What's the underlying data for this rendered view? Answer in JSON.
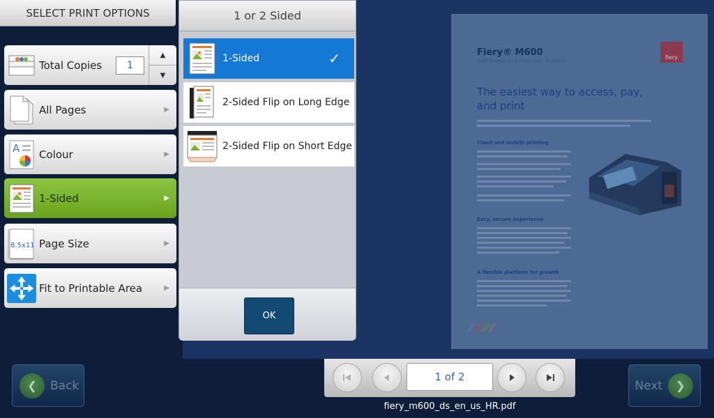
{
  "sidebar": {
    "title": "SELECT PRINT OPTIONS",
    "copies": {
      "label": "Total Copies",
      "value": "1"
    },
    "items": [
      {
        "label": "All Pages",
        "icon": "pages-icon"
      },
      {
        "label": "Colour",
        "icon": "colour-icon"
      },
      {
        "label": "1-Sided",
        "icon": "sided-icon",
        "active": true
      },
      {
        "label": "Page Size",
        "icon": "page-size-icon",
        "icon_text": "8.5x11"
      },
      {
        "label": "Fit to Printable Area",
        "icon": "fit-area-icon"
      }
    ]
  },
  "panel": {
    "title": "1 or 2 Sided",
    "options": [
      {
        "label": "1-Sided",
        "selected": true
      },
      {
        "label": "2-Sided Flip on Long Edge",
        "selected": false
      },
      {
        "label": "2-Sided Flip on Short Edge",
        "selected": false
      }
    ],
    "ok_label": "OK",
    "check": "✓"
  },
  "preview": {
    "brand": "Fiery® M600",
    "subtitle": "Self-Serve and Payment System",
    "headline": "The easiest way to access, pay, and print",
    "logo": "fiery",
    "sections": [
      "Cloud and mobile printing",
      "Easy, secure experience",
      "A flexible platform for growth"
    ]
  },
  "nav": {
    "back_label": "Back",
    "next_label": "Next",
    "page_indicator": "1 of 2",
    "filename": "fiery_m600_ds_en_us_HR.pdf"
  },
  "colors": {
    "active_green": "#7ab52c",
    "selected_blue": "#1479d4",
    "ok_blue": "#134a73"
  }
}
